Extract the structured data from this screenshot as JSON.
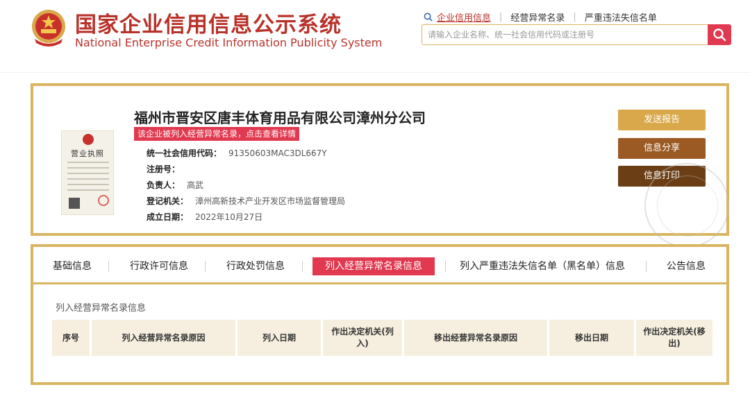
{
  "header": {
    "title_cn": "国家企业信用信息公示系统",
    "title_en": "National Enterprise Credit Information Publicity System",
    "nav": [
      {
        "label": "企业信用信息",
        "active": true
      },
      {
        "label": "经营异常名录",
        "active": false
      },
      {
        "label": "严重违法失信名单",
        "active": false
      }
    ],
    "search_placeholder": "请输入企业名称、统一社会信用代码或注册号"
  },
  "company": {
    "license_title": "营业执照",
    "name": "福州市晋安区唐丰体育用品有限公司漳州分公司",
    "abnormal_notice": "该企业被列入经营异常名录，点击查看详情",
    "fields": [
      {
        "label": "统一社会信用代码：",
        "value": "91350603MAC3DL667Y"
      },
      {
        "label": "注册号：",
        "value": ""
      },
      {
        "label": "负责人：",
        "value": "高武"
      },
      {
        "label": "登记机关：",
        "value": "漳州高新技术产业开发区市场监督管理局"
      },
      {
        "label": "成立日期：",
        "value": "2022年10月27日"
      }
    ],
    "actions": {
      "send_report": "发送报告",
      "share": "信息分享",
      "print": "信息打印"
    }
  },
  "tabs": [
    {
      "label": "基础信息",
      "active": false
    },
    {
      "label": "行政许可信息",
      "active": false
    },
    {
      "label": "行政处罚信息",
      "active": false
    },
    {
      "label": "列入经营异常名录信息",
      "active": true
    },
    {
      "label": "列入严重违法失信名单（黑名单）信息",
      "active": false
    },
    {
      "label": "公告信息",
      "active": false
    }
  ],
  "section": {
    "title": "列入经营异常名录信息",
    "columns": [
      "序号",
      "列入经营异常名录原因",
      "列入日期",
      "作出决定机关(列入)",
      "移出经营异常名录原因",
      "移出日期",
      "作出决定机关(移出)"
    ]
  },
  "colors": {
    "brand_red": "#b8322a",
    "accent_red": "#e1394f",
    "gold_border": "#d9b561",
    "btn_send": "#d9a84a",
    "btn_share": "#9b5a23",
    "btn_print": "#6b3e15",
    "table_header_bg": "#f6efdf"
  }
}
